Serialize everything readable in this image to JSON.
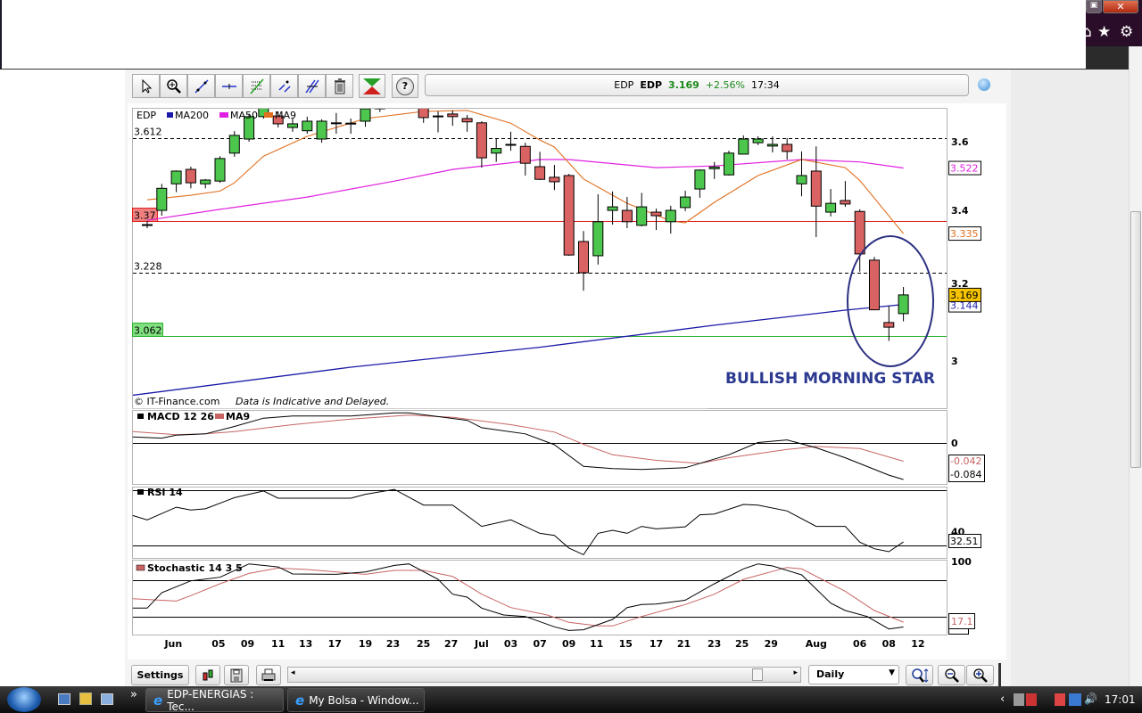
{
  "window": {
    "restore_label": "▣",
    "close_label": "✕"
  },
  "ie_toolbar": {
    "icons": [
      "home-icon",
      "favorites-star-icon",
      "tools-gear-icon"
    ]
  },
  "toolbar": {
    "tools": [
      "pointer-tool",
      "zoom-tool",
      "trend-line-tool",
      "horizontal-line-tool",
      "fibonacci-tool",
      "parallel-lines-tool",
      "fan-lines-tool",
      "delete-tool"
    ],
    "help_label": "?",
    "quote": {
      "name": "EDP",
      "symbol": "EDP",
      "price": "3.169",
      "change": "+2.56%",
      "time": "17:34"
    }
  },
  "colors": {
    "up": "#4cc64c",
    "down": "#d96363",
    "ma200": "#1a1aa8",
    "ma50": "#e020e0",
    "ma9": "#e07020",
    "annotation": "#2b3990",
    "signal": "#c86464"
  },
  "chart_data": [
    {
      "type": "bar",
      "style": "candlestick",
      "title": "EDP",
      "legend": {
        "symbol": "EDP",
        "ma200": "MA200",
        "ma50": "MA50",
        "ma9": "MA9"
      },
      "y_scale": "log",
      "ylim": [
        2.9,
        3.75
      ],
      "y_ticks": [
        {
          "v": 3.6,
          "label": "3.6"
        },
        {
          "v": 3.4,
          "label": "3.4"
        },
        {
          "v": 3.2,
          "label": "3.2"
        },
        {
          "v": 3.0,
          "label": "3"
        }
      ],
      "levels": [
        {
          "value": 3.612,
          "label": "3.612",
          "style": "dashed"
        },
        {
          "value": 3.37,
          "label": "3.37",
          "style": "red"
        },
        {
          "value": 3.228,
          "label": "3.228",
          "style": "dashed"
        },
        {
          "value": 3.062,
          "label": "3.062",
          "style": "green"
        }
      ],
      "last_values": {
        "ma50": {
          "v": 3.522,
          "label": "3.522"
        },
        "ma9": {
          "v": 3.335,
          "label": "3.335"
        },
        "close": {
          "v": 3.169,
          "label": "3.169"
        },
        "ma200": {
          "v": 3.144,
          "label": "3.144"
        }
      },
      "candles_ohlc": [
        [
          3.36,
          3.37,
          3.35,
          3.36
        ],
        [
          3.4,
          3.476,
          3.385,
          3.463
        ],
        [
          3.476,
          3.515,
          3.452,
          3.513
        ],
        [
          3.518,
          3.526,
          3.463,
          3.479
        ],
        [
          3.476,
          3.49,
          3.463,
          3.487
        ],
        [
          3.484,
          3.557,
          3.479,
          3.55
        ],
        [
          3.566,
          3.632,
          3.555,
          3.619
        ],
        [
          3.608,
          3.684,
          3.6,
          3.676
        ],
        [
          3.676,
          3.73,
          3.67,
          3.71
        ],
        [
          3.678,
          3.692,
          3.643,
          3.654
        ],
        [
          3.643,
          3.67,
          3.63,
          3.654
        ],
        [
          3.633,
          3.676,
          3.624,
          3.662
        ],
        [
          3.608,
          3.668,
          3.597,
          3.662
        ],
        [
          3.656,
          3.687,
          3.624,
          3.657
        ],
        [
          3.655,
          3.67,
          3.624,
          3.656
        ],
        [
          3.662,
          3.719,
          3.645,
          3.7
        ],
        [
          3.7,
          3.73,
          3.69,
          3.72
        ],
        [
          3.71,
          3.725,
          3.7,
          3.711
        ],
        [
          3.71,
          3.73,
          3.7,
          3.72
        ],
        [
          3.719,
          3.73,
          3.657,
          3.673
        ],
        [
          3.678,
          3.692,
          3.628,
          3.677
        ],
        [
          3.684,
          3.695,
          3.648,
          3.676
        ],
        [
          3.67,
          3.681,
          3.63,
          3.66
        ],
        [
          3.657,
          3.662,
          3.523,
          3.552
        ],
        [
          3.566,
          3.61,
          3.54,
          3.58
        ],
        [
          3.592,
          3.63,
          3.573,
          3.591
        ],
        [
          3.586,
          3.597,
          3.5,
          3.536
        ],
        [
          3.526,
          3.57,
          3.487,
          3.489
        ],
        [
          3.495,
          3.531,
          3.458,
          3.482
        ],
        [
          3.5,
          3.505,
          3.274,
          3.276
        ],
        [
          3.313,
          3.342,
          3.18,
          3.228
        ],
        [
          3.274,
          3.446,
          3.25,
          3.368
        ],
        [
          3.4,
          3.454,
          3.36,
          3.41
        ],
        [
          3.4,
          3.438,
          3.35,
          3.368
        ],
        [
          3.358,
          3.45,
          3.355,
          3.41
        ],
        [
          3.395,
          3.405,
          3.345,
          3.385
        ],
        [
          3.368,
          3.413,
          3.335,
          3.4
        ],
        [
          3.408,
          3.456,
          3.398,
          3.438
        ],
        [
          3.461,
          3.518,
          3.436,
          3.516
        ],
        [
          3.52,
          3.54,
          3.49,
          3.525
        ],
        [
          3.502,
          3.573,
          3.5,
          3.566
        ],
        [
          3.563,
          3.619,
          3.562,
          3.608
        ],
        [
          3.597,
          3.616,
          3.59,
          3.608
        ],
        [
          3.587,
          3.616,
          3.568,
          3.592
        ],
        [
          3.592,
          3.611,
          3.547,
          3.571
        ],
        [
          3.476,
          3.571,
          3.44,
          3.5
        ],
        [
          3.513,
          3.586,
          3.325,
          3.412
        ],
        [
          3.395,
          3.461,
          3.383,
          3.42
        ],
        [
          3.428,
          3.484,
          3.41,
          3.418
        ],
        [
          3.397,
          3.403,
          3.231,
          3.279
        ],
        [
          3.262,
          3.271,
          3.13,
          3.13
        ],
        [
          3.097,
          3.14,
          3.05,
          3.085
        ],
        [
          3.12,
          3.19,
          3.1,
          3.169
        ]
      ],
      "ma9": [
        [
          0,
          3.43
        ],
        [
          3,
          3.443
        ],
        [
          5,
          3.455
        ],
        [
          6,
          3.479
        ],
        [
          8,
          3.557
        ],
        [
          11,
          3.616
        ],
        [
          15,
          3.67
        ],
        [
          19,
          3.692
        ],
        [
          22,
          3.695
        ],
        [
          25,
          3.656
        ],
        [
          27,
          3.605
        ],
        [
          28,
          3.584
        ],
        [
          30,
          3.49
        ],
        [
          33,
          3.42
        ],
        [
          36,
          3.37
        ],
        [
          37,
          3.365
        ],
        [
          39,
          3.423
        ],
        [
          42,
          3.5
        ],
        [
          45,
          3.547
        ],
        [
          48,
          3.523
        ],
        [
          49,
          3.486
        ],
        [
          52,
          3.335
        ]
      ],
      "ma50": [
        [
          0,
          3.372
        ],
        [
          5,
          3.403
        ],
        [
          11,
          3.438
        ],
        [
          17,
          3.484
        ],
        [
          21,
          3.518
        ],
        [
          27,
          3.547
        ],
        [
          29,
          3.547
        ],
        [
          35,
          3.523
        ],
        [
          39,
          3.528
        ],
        [
          45,
          3.547
        ],
        [
          49,
          3.54
        ],
        [
          52,
          3.522
        ]
      ],
      "ma200": [
        [
          -1,
          2.915
        ],
        [
          14,
          2.984
        ],
        [
          27,
          3.034
        ],
        [
          39,
          3.09
        ],
        [
          48,
          3.129
        ],
        [
          52,
          3.144
        ]
      ],
      "annotation": "BULLISH MORNING STAR",
      "credit": "© IT-Finance.com",
      "disclaimer": "Data is Indicative and Delayed."
    },
    {
      "type": "line",
      "title": "MACD 12 26",
      "signal_label": "MA9",
      "ylim": [
        -0.09,
        0.075
      ],
      "zero_label": "0",
      "macd": [
        [
          -1,
          0.014
        ],
        [
          1,
          0.011
        ],
        [
          2,
          0.018
        ],
        [
          4,
          0.021
        ],
        [
          6,
          0.038
        ],
        [
          8,
          0.057
        ],
        [
          10,
          0.062
        ],
        [
          14,
          0.062
        ],
        [
          17,
          0.069
        ],
        [
          18,
          0.069
        ],
        [
          22,
          0.052
        ],
        [
          23,
          0.035
        ],
        [
          26,
          0.021
        ],
        [
          28,
          -0.004
        ],
        [
          30,
          -0.054
        ],
        [
          32,
          -0.059
        ],
        [
          34,
          -0.061
        ],
        [
          37,
          -0.057
        ],
        [
          40,
          -0.027
        ],
        [
          42,
          0.001
        ],
        [
          44,
          0.007
        ],
        [
          46,
          -0.011
        ],
        [
          48,
          -0.034
        ],
        [
          51,
          -0.074
        ],
        [
          52,
          -0.084
        ]
      ],
      "signal": [
        [
          -1,
          0.026
        ],
        [
          2,
          0.019
        ],
        [
          4,
          0.021
        ],
        [
          6,
          0.026
        ],
        [
          10,
          0.042
        ],
        [
          14,
          0.055
        ],
        [
          18,
          0.064
        ],
        [
          21,
          0.059
        ],
        [
          25,
          0.042
        ],
        [
          28,
          0.025
        ],
        [
          30,
          -0.003
        ],
        [
          32,
          -0.027
        ],
        [
          35,
          -0.04
        ],
        [
          38,
          -0.047
        ],
        [
          40,
          -0.034
        ],
        [
          44,
          -0.015
        ],
        [
          46,
          -0.008
        ],
        [
          49,
          -0.013
        ],
        [
          52,
          -0.042
        ]
      ],
      "last_values": {
        "signal": "-0.042",
        "macd": "-0.084"
      }
    },
    {
      "type": "line",
      "title": "RSI 14",
      "ylim": [
        20,
        75
      ],
      "levels": [
        70,
        30
      ],
      "tick_label": {
        "v": 40,
        "label": "40"
      },
      "rsi": [
        [
          -1,
          51.7
        ],
        [
          0,
          48.5
        ],
        [
          2,
          57.7
        ],
        [
          3,
          55.6
        ],
        [
          4,
          56.5
        ],
        [
          6,
          64.6
        ],
        [
          8,
          69.4
        ],
        [
          9,
          64.2
        ],
        [
          10,
          64.2
        ],
        [
          14,
          64.2
        ],
        [
          15,
          67
        ],
        [
          17,
          70.6
        ],
        [
          19,
          59.2
        ],
        [
          21,
          59.2
        ],
        [
          23,
          43.8
        ],
        [
          25,
          48.5
        ],
        [
          27,
          38.8
        ],
        [
          28,
          37.3
        ],
        [
          29,
          28.1
        ],
        [
          30,
          23.3
        ],
        [
          31,
          38.8
        ],
        [
          32,
          41
        ],
        [
          33,
          38.8
        ],
        [
          34,
          43.8
        ],
        [
          35,
          42
        ],
        [
          37,
          43.5
        ],
        [
          38,
          52.2
        ],
        [
          39,
          52.8
        ],
        [
          41,
          59.7
        ],
        [
          42,
          59.2
        ],
        [
          44,
          55
        ],
        [
          46,
          43.8
        ],
        [
          48,
          43.8
        ],
        [
          49,
          32.4
        ],
        [
          50,
          27.6
        ],
        [
          51,
          25.5
        ],
        [
          52,
          32.5
        ]
      ],
      "last_value": "32.51"
    },
    {
      "type": "line",
      "title": "Stochastic 14 3 5",
      "ylim": [
        0,
        100
      ],
      "levels": [
        75,
        25
      ],
      "tick_label": {
        "v": 100,
        "label": "100"
      },
      "k": [
        [
          -1,
          36.5
        ],
        [
          0,
          36.5
        ],
        [
          1,
          57.8
        ],
        [
          3,
          74.2
        ],
        [
          5,
          79.1
        ],
        [
          7,
          97.5
        ],
        [
          9,
          93.4
        ],
        [
          10,
          83.6
        ],
        [
          13,
          83.2
        ],
        [
          15,
          86.5
        ],
        [
          17,
          95.5
        ],
        [
          18,
          97.5
        ],
        [
          20,
          76.2
        ],
        [
          21,
          55.7
        ],
        [
          22,
          51.6
        ],
        [
          23,
          36.5
        ],
        [
          24.5,
          27
        ],
        [
          26,
          25
        ],
        [
          28,
          10.7
        ],
        [
          29,
          5.7
        ],
        [
          30,
          6.6
        ],
        [
          32,
          20.9
        ],
        [
          33,
          37.3
        ],
        [
          34,
          41.4
        ],
        [
          35,
          42.2
        ],
        [
          37,
          47.5
        ],
        [
          39,
          70.1
        ],
        [
          41,
          90.6
        ],
        [
          42,
          97.5
        ],
        [
          43,
          94.7
        ],
        [
          45,
          82.4
        ],
        [
          47,
          43.4
        ],
        [
          48,
          33.2
        ],
        [
          49.5,
          25
        ],
        [
          51,
          7.8
        ],
        [
          52,
          10.5
        ]
      ],
      "d": [
        [
          -1,
          49.6
        ],
        [
          2,
          46.3
        ],
        [
          3,
          53.7
        ],
        [
          5,
          70.1
        ],
        [
          7,
          84.4
        ],
        [
          9,
          91.8
        ],
        [
          11,
          89.8
        ],
        [
          15,
          83.2
        ],
        [
          17,
          88.5
        ],
        [
          19,
          88.5
        ],
        [
          21,
          80.3
        ],
        [
          23,
          55.7
        ],
        [
          25,
          37.3
        ],
        [
          27.5,
          27
        ],
        [
          29,
          16.8
        ],
        [
          31,
          11.9
        ],
        [
          32,
          11.9
        ],
        [
          34,
          25
        ],
        [
          37,
          41.4
        ],
        [
          39,
          55.7
        ],
        [
          41,
          76.2
        ],
        [
          44,
          92.6
        ],
        [
          45,
          90.6
        ],
        [
          48,
          59.8
        ],
        [
          50,
          33.2
        ],
        [
          52,
          17.1
        ]
      ],
      "last_value": "17.1"
    }
  ],
  "x_axis": [
    {
      "i": 1.8,
      "label": "Jun"
    },
    {
      "i": 4.9,
      "label": "05"
    },
    {
      "i": 6.9,
      "label": "09"
    },
    {
      "i": 9,
      "label": "11"
    },
    {
      "i": 10.9,
      "label": "13"
    },
    {
      "i": 12.9,
      "label": "17"
    },
    {
      "i": 15,
      "label": "19"
    },
    {
      "i": 16.9,
      "label": "23"
    },
    {
      "i": 19,
      "label": "25"
    },
    {
      "i": 20.9,
      "label": "27"
    },
    {
      "i": 23,
      "label": "Jul"
    },
    {
      "i": 25,
      "label": "03"
    },
    {
      "i": 27,
      "label": "07"
    },
    {
      "i": 29,
      "label": "09"
    },
    {
      "i": 30.9,
      "label": "11"
    },
    {
      "i": 32.9,
      "label": "15"
    },
    {
      "i": 35,
      "label": "17"
    },
    {
      "i": 36.9,
      "label": "21"
    },
    {
      "i": 39,
      "label": "23"
    },
    {
      "i": 40.9,
      "label": "25"
    },
    {
      "i": 42.9,
      "label": "29"
    },
    {
      "i": 46,
      "label": "Aug"
    },
    {
      "i": 49,
      "label": "06"
    },
    {
      "i": 51,
      "label": "08"
    },
    {
      "i": 53,
      "label": "12"
    }
  ],
  "bottom_bar": {
    "settings_label": "Settings",
    "period": "Daily"
  },
  "taskbar": {
    "more": "»",
    "tasks": [
      {
        "label": "EDP-ENERGIAS : Tec..."
      },
      {
        "label": "My Bolsa - Window..."
      }
    ],
    "tray_arrow": "‹",
    "clock": "17:01"
  }
}
